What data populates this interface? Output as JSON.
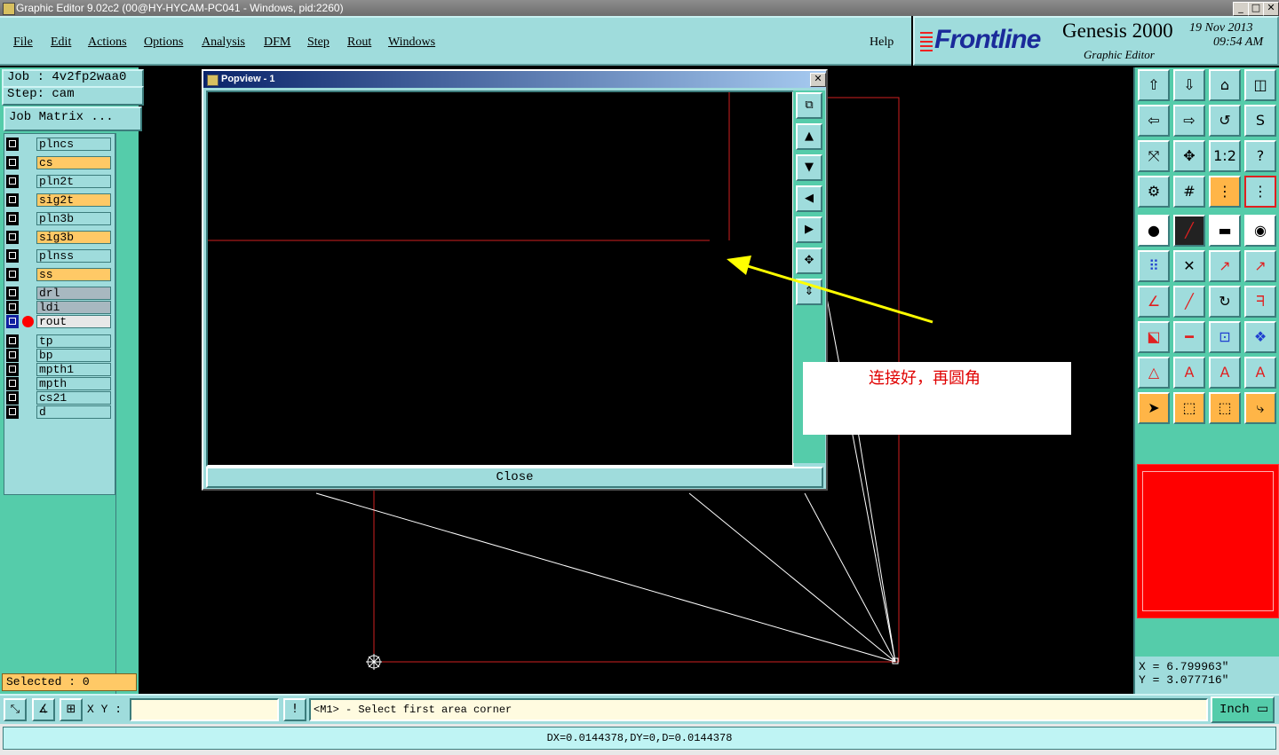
{
  "window": {
    "title": "Graphic Editor 9.02c2 (00@HY-HYCAM-PC041 - Windows, pid:2260)",
    "min": "_",
    "max": "□",
    "close": "✕"
  },
  "menu": [
    {
      "label": "File"
    },
    {
      "label": "Edit"
    },
    {
      "label": "Actions"
    },
    {
      "label": "Options"
    },
    {
      "label": "Analysis"
    },
    {
      "label": "DFM"
    },
    {
      "label": "Step"
    },
    {
      "label": "Rout"
    },
    {
      "label": "Windows"
    },
    {
      "label": "Help"
    }
  ],
  "brand": {
    "logo": "Frontline",
    "product": "Genesis 2000",
    "module": "Graphic Editor",
    "date": "19  Nov  2013",
    "time": "09:54  AM"
  },
  "job": {
    "job_label": "Job : 4v2fp2waa0",
    "step_label": "Step: cam",
    "matrix_button": "Job Matrix ..."
  },
  "layers": [
    {
      "name": "plncs",
      "color": "#9fdcdc"
    },
    {
      "name": "cs",
      "color": "#ffc966"
    },
    {
      "name": "pln2t",
      "color": "#9fdcdc"
    },
    {
      "name": "sig2t",
      "color": "#ffc966"
    },
    {
      "name": "pln3b",
      "color": "#9fdcdc"
    },
    {
      "name": "sig3b",
      "color": "#ffc966"
    },
    {
      "name": "plnss",
      "color": "#9fdcdc"
    },
    {
      "name": "ss",
      "color": "#ffc966"
    },
    {
      "name": "drl",
      "color": "#a8b8c0"
    },
    {
      "name": "ldi",
      "color": "#a8b8c0"
    },
    {
      "name": "rout",
      "color": "#e8e8e8"
    },
    {
      "name": "tp",
      "color": "#9fdcdc"
    },
    {
      "name": "bp",
      "color": "#9fdcdc"
    },
    {
      "name": "mpth1",
      "color": "#9fdcdc"
    },
    {
      "name": "mpth",
      "color": "#9fdcdc"
    },
    {
      "name": "cs21",
      "color": "#9fdcdc"
    },
    {
      "name": "d",
      "color": "#9fdcdc"
    }
  ],
  "selected": "Selected : 0",
  "popview": {
    "title": "Popview - 1",
    "close_button": "Close"
  },
  "annotation": "连接好，再圆角",
  "coords": {
    "x": "X = 6.799963\"",
    "y": "Y = 3.077716\""
  },
  "bottom": {
    "xy_label": "X Y :",
    "xy_value": "",
    "bang": "!",
    "prompt": "<M1> - Select first area corner",
    "unit": "Inch"
  },
  "status": "DX=0.0144378,DY=0,D=0.0144378",
  "colors": {
    "panel": "#9fdcdc",
    "green": "#55ccaa",
    "active_layer": "#ffc966",
    "preview": "#ff0000",
    "note": "#e00000"
  }
}
